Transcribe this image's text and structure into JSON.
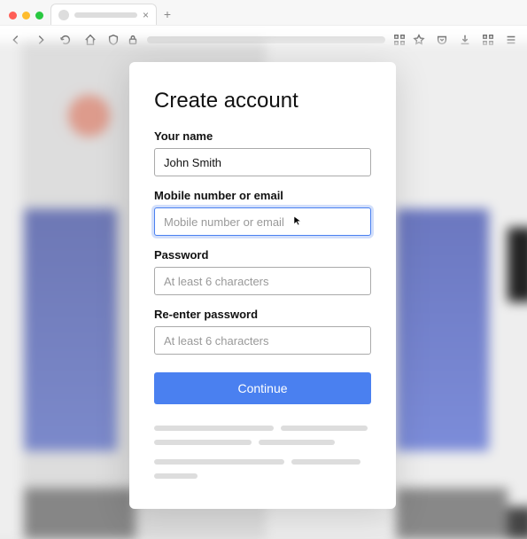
{
  "form": {
    "title": "Create account",
    "name_label": "Your name",
    "name_value": "John Smith",
    "contact_label": "Mobile number or email",
    "contact_placeholder": "Mobile number or email",
    "password_label": "Password",
    "password_placeholder": "At least 6 characters",
    "reenter_label": "Re-enter password",
    "reenter_placeholder": "At least 6 characters",
    "continue_label": "Continue"
  }
}
